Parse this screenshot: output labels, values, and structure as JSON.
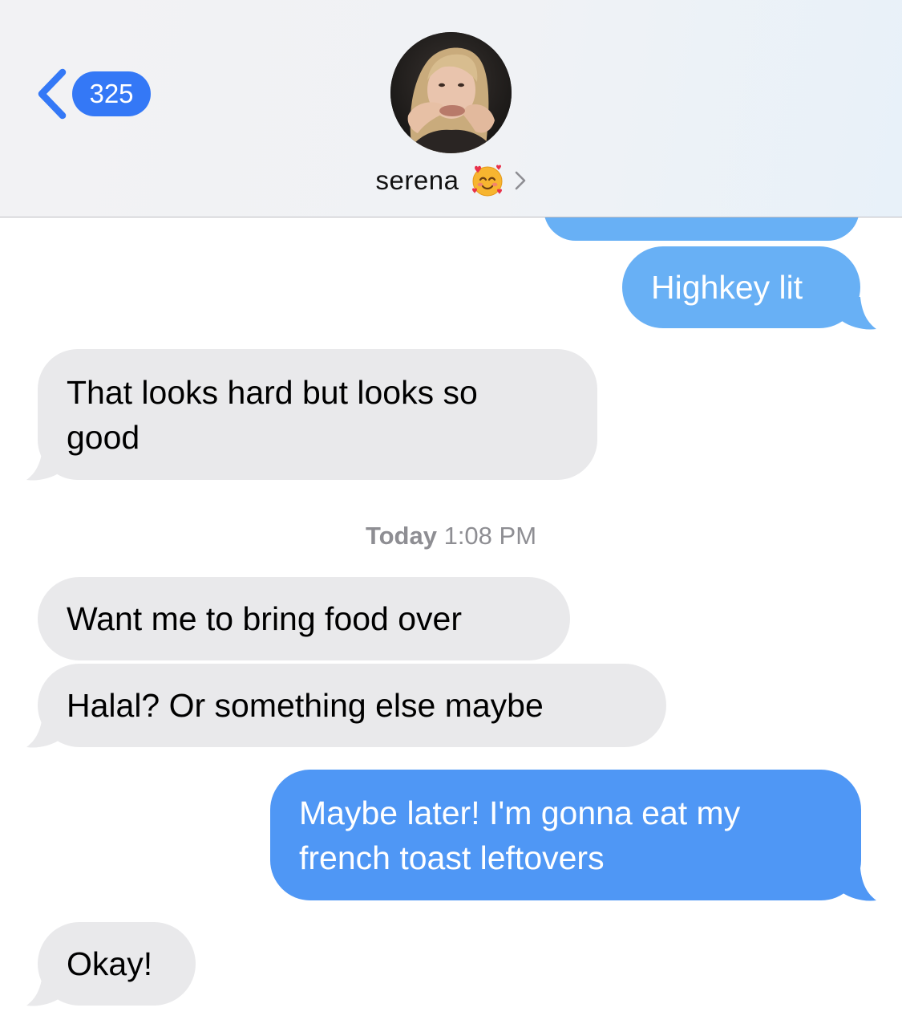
{
  "header": {
    "back_count": "325",
    "contact_name": "serena",
    "contact_emoji": "smiling-face-with-hearts",
    "avatar": "contact-photo"
  },
  "messages": [
    {
      "direction": "outgoing",
      "text": ""
    },
    {
      "direction": "outgoing",
      "text": "Highkey lit"
    },
    {
      "direction": "incoming",
      "lines": [
        "That looks hard but looks so",
        "good"
      ]
    },
    {
      "direction": "incoming",
      "text": "Want me to bring food over"
    },
    {
      "direction": "incoming",
      "text": "Halal? Or something else maybe"
    },
    {
      "direction": "outgoing",
      "lines": [
        "Maybe later! I'm gonna eat my",
        "french toast leftovers"
      ]
    },
    {
      "direction": "incoming",
      "text": "Okay!"
    }
  ],
  "timestamp": {
    "day": "Today",
    "time": "1:08 PM"
  },
  "colors": {
    "accent": "#3478f6",
    "incoming_bubble": "#e9e9eb",
    "outgoing_bubble_light": "#68b0f5",
    "outgoing_bubble": "#4f97f5",
    "timestamp_text": "#8e8e93"
  }
}
